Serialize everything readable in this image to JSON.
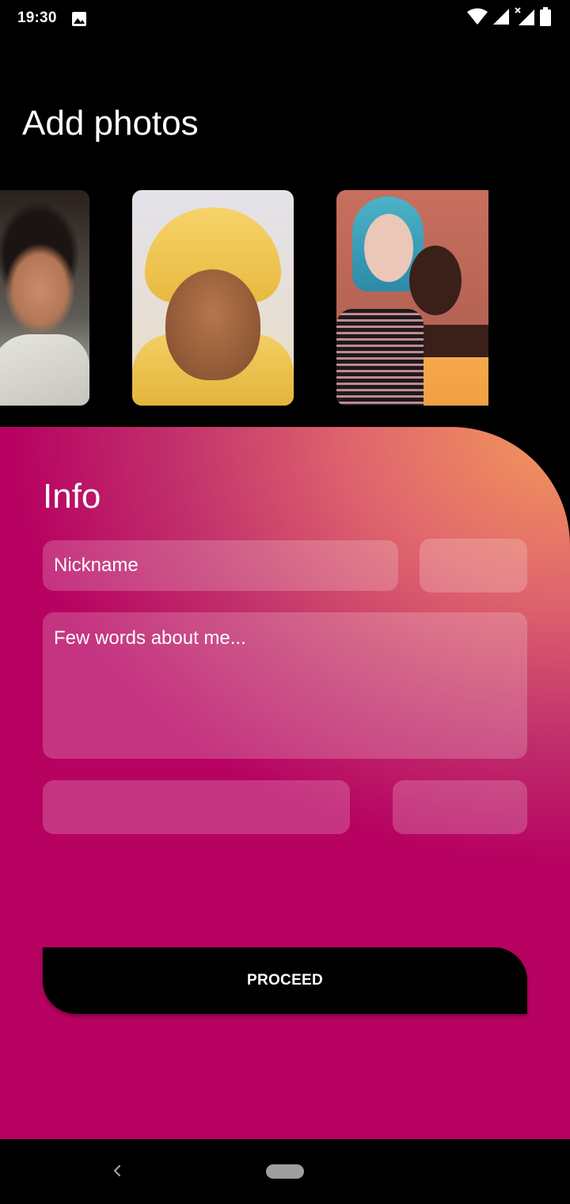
{
  "status_bar": {
    "time": "19:30",
    "icons": [
      "gallery-icon",
      "wifi-icon",
      "signal-icon",
      "signal-no-data-icon",
      "battery-icon"
    ]
  },
  "header": {
    "title": "Add photos"
  },
  "photos": [
    {
      "name": "photo-woman-portrait"
    },
    {
      "name": "photo-man-yellow-turban"
    },
    {
      "name": "photo-two-women"
    }
  ],
  "info": {
    "title": "Info",
    "nickname_placeholder": "Nickname",
    "about_placeholder": "Few words about me...",
    "field_small_1": "",
    "field_bottom_left": "",
    "field_bottom_right": ""
  },
  "actions": {
    "proceed_label": "PROCEED"
  },
  "colors": {
    "background": "#000000",
    "panel_base": "#b70262",
    "panel_accent": "#f49a59",
    "button": "#000000"
  },
  "nav_bar": {
    "icons": [
      "back-icon",
      "home-pill-icon"
    ]
  }
}
